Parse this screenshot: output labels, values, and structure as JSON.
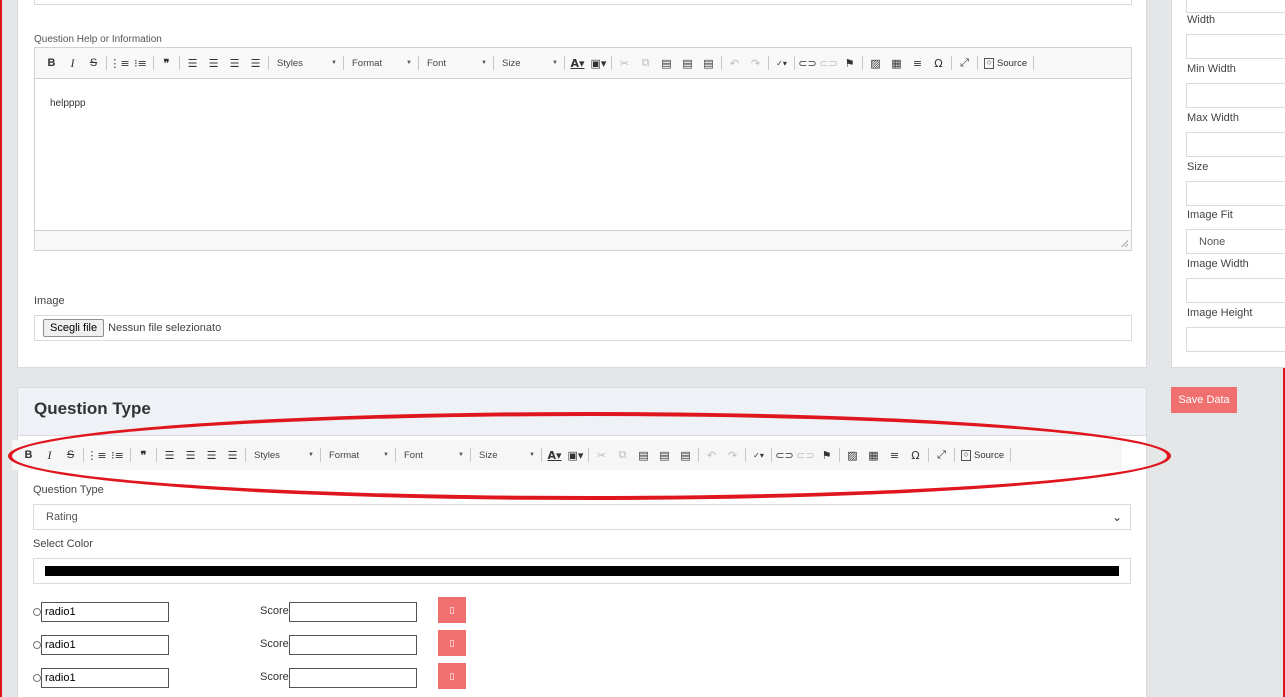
{
  "help_editor": {
    "label": "Question Help or Information",
    "content": "helpppp"
  },
  "toolbar": {
    "bold": "B",
    "italic": "I",
    "strike": "S",
    "numbered_list_icon": "ordered-list-icon",
    "bullet_list_icon": "bullet-list-icon",
    "quote": "❞",
    "styles": "Styles",
    "format": "Format",
    "font": "Font",
    "size": "Size",
    "source": "Source"
  },
  "image": {
    "label": "Image",
    "button": "Scegli file",
    "status": "Nessun file selezionato"
  },
  "question_type_section": {
    "title": "Question Type",
    "type_label": "Question Type",
    "type_value": "Rating",
    "color_label": "Select Color",
    "color_value": "#000000"
  },
  "options": [
    {
      "value": "radio1",
      "score_label": "Score",
      "score_value": ""
    },
    {
      "value": "radio1",
      "score_label": "Score",
      "score_value": ""
    },
    {
      "value": "radio1",
      "score_label": "Score",
      "score_value": ""
    }
  ],
  "sidebar": {
    "width_label": "Width",
    "min_width_label": "Min Width",
    "max_width_label": "Max Width",
    "size_label": "Size",
    "image_fit_label": "Image Fit",
    "image_fit_value": "None",
    "image_width_label": "Image Width",
    "image_height_label": "Image Height",
    "save_button": "Save Data"
  },
  "colors": {
    "accent": "#f07070",
    "annotation": "#e0161e"
  }
}
